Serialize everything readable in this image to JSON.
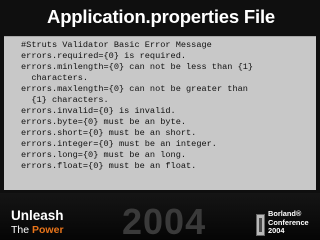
{
  "slide": {
    "title": "Application.properties File",
    "code_lines": [
      "#Struts Validator Basic Error Message",
      "errors.required={0} is required.",
      "errors.minlength={0} can not be less than {1}",
      "  characters.",
      "errors.maxlength={0} can not be greater than",
      "  {1} characters.",
      "errors.invalid={0} is invalid.",
      "errors.byte={0} must be an byte.",
      "errors.short={0} must be an short.",
      "errors.integer={0} must be an integer.",
      "errors.long={0} must be an long.",
      "errors.float={0} must be an float."
    ]
  },
  "footer": {
    "unleash": "Unleash",
    "the": "The ",
    "power": "Power",
    "year": "2004",
    "brand_line1": "Borland®",
    "brand_line2": "Conference",
    "brand_line3": "2004"
  },
  "colors": {
    "background": "#0f0f0f",
    "panel": "#c8c8c8",
    "accent": "#e8741a"
  }
}
